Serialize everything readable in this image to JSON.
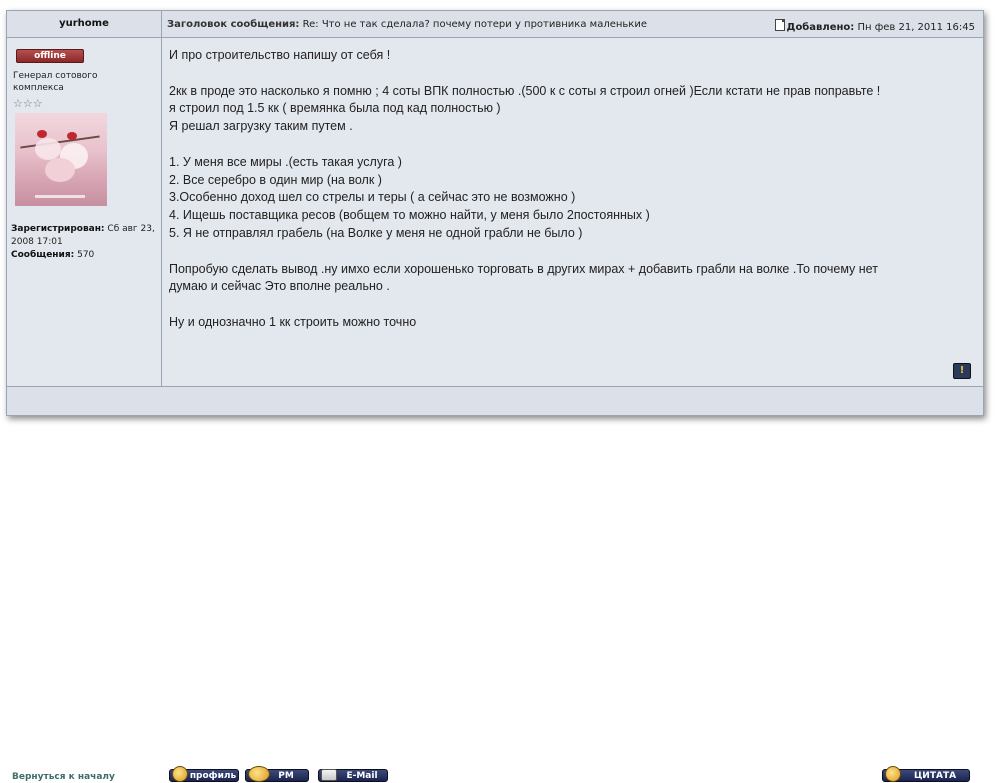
{
  "header": {
    "username": "yurhome",
    "subject_label": "Заголовок сообщения:",
    "subject_text": "Re: Что не так сделала? почему потери у противника маленькие",
    "posted_label": "Добавлено:",
    "posted_date": "Пн фев 21, 2011 16:45"
  },
  "profile": {
    "status": "offline",
    "rank": "Генерал сотового комплекса",
    "stars": "☆☆☆",
    "registered_label": "Зарегистрирован:",
    "registered_value": "Сб авг 23, 2008 17:01",
    "posts_label": "Сообщения:",
    "posts_value": "570"
  },
  "message": {
    "lines": [
      "И про строительство напишу от себя !",
      "",
      "2кк в проде это насколько я помню ; 4 соты ВПК полностью .(500 к с соты я строил огней )Если кстати не прав поправьте !",
      "я строил под 1.5 кк ( времянка была под кад полностью )",
      "Я решал загрузку таким путем .",
      "",
      "1. У меня все миры .(есть такая услуга )",
      "2. Все серебро в один мир (на волк )",
      "3.Особенно доход шел со стрелы и теры ( а сейчас это не возможно )",
      "4. Ищешь поставщика ресов (вобщем то можно найти, у меня было 2постоянных )",
      "5. Я не отправлял грабель (на Волке у меня не одной грабли не было )",
      "",
      "Попробую сделать вывод .ну имхо если хорошенько торговать в других мирах + добавить грабли на волке .То почему нет",
      "думаю и сейчас Это вполне реально .",
      "",
      "Ну и однозначно 1 кк строить можно точно"
    ]
  },
  "footer": {
    "back_to_top": "Вернуться к началу",
    "profile_button": "профиль",
    "pm_button": "PM",
    "email_button": "E-Mail",
    "quote_button": "ЦИТАТА",
    "report_icon": "warning-icon"
  },
  "colors": {
    "panel_bg": "#e3e7ee",
    "border": "#9aa4b4",
    "offline_badge": "#9a3434",
    "button_bg": "#1a2450",
    "link": "#3c6e6a"
  }
}
